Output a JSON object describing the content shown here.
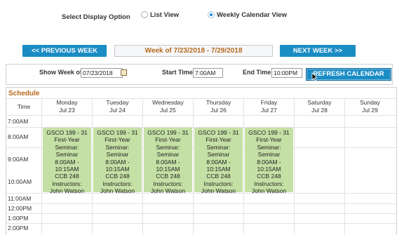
{
  "display": {
    "label": "Select Display Option",
    "options": [
      {
        "label": "List View",
        "selected": false
      },
      {
        "label": "Weekly Calendar View",
        "selected": true
      }
    ]
  },
  "nav": {
    "prev_label": "<< PREVIOUS WEEK",
    "week_title": "Week of 7/23/2018 - 7/29/2018",
    "next_label": "NEXT WEEK >>"
  },
  "controls": {
    "show_week_label": "Show Week of",
    "show_week_value": "07/23/2018",
    "start_label": "Start Time",
    "start_value": "7:00AM",
    "end_label": "End Time",
    "end_value": "10:00PM",
    "refresh_label": "REFRESH CALENDAR"
  },
  "schedule": {
    "title": "Schedule",
    "time_header": "Time",
    "days": [
      {
        "name": "Monday",
        "date": "Jul 23"
      },
      {
        "name": "Tuesday",
        "date": "Jul 24"
      },
      {
        "name": "Wednesday",
        "date": "Jul 25"
      },
      {
        "name": "Thursday",
        "date": "Jul 26"
      },
      {
        "name": "Friday",
        "date": "Jul 27"
      },
      {
        "name": "Saturday",
        "date": "Jul 28"
      },
      {
        "name": "Sunday",
        "date": "Jul 29"
      }
    ],
    "times": [
      "7:00AM",
      "8:00AM",
      "9:00AM",
      "10:00AM",
      "11:00AM",
      "12:00PM",
      "1:00PM",
      "2:00PM"
    ],
    "event": {
      "lines": [
        "GSCO 199 - 31",
        "First-Year",
        "Seminar:",
        "Seminar",
        "8:00AM -",
        "10:15AM",
        "CCB 248",
        "Instructors:",
        "John Watson"
      ],
      "color": "#c5e0a5",
      "days": [
        0,
        1,
        2,
        3,
        4
      ]
    }
  },
  "colors": {
    "accent": "#1a8cc4",
    "title_orange": "#b56a1e"
  }
}
